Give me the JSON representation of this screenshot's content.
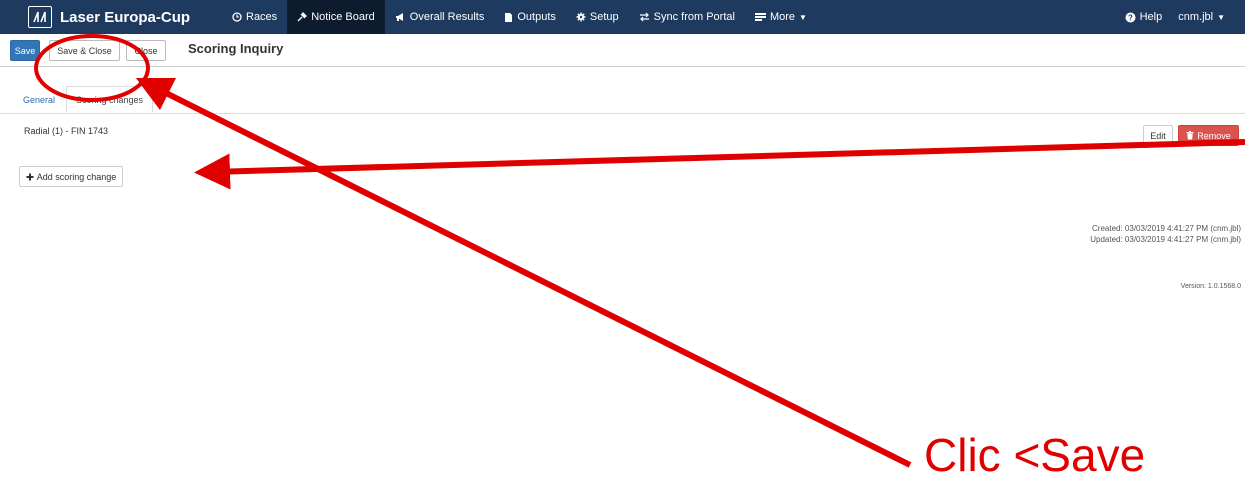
{
  "navbar": {
    "brand": "Laser Europa-Cup",
    "items": [
      {
        "label": "Races",
        "icon": "clock-icon"
      },
      {
        "label": "Notice Board",
        "icon": "pin-icon",
        "active": true
      },
      {
        "label": "Overall Results",
        "icon": "megaphone-icon"
      },
      {
        "label": "Outputs",
        "icon": "file-icon"
      },
      {
        "label": "Setup",
        "icon": "gear-icon"
      },
      {
        "label": "Sync from Portal",
        "icon": "sync-icon"
      },
      {
        "label": "More",
        "icon": "list-icon"
      }
    ],
    "help": "Help",
    "user": "cnm.jbl"
  },
  "toolbar": {
    "save": "Save",
    "save_close": "Save & Close",
    "close": "Close"
  },
  "page": {
    "title": "Scoring Inquiry"
  },
  "tabs": [
    {
      "label": "General"
    },
    {
      "label": "Scoring changes",
      "active": true
    }
  ],
  "scoring": {
    "item": "Radial (1) - FIN 1743",
    "edit": "Edit",
    "remove": "Remove",
    "add": "Add scoring change"
  },
  "meta": {
    "created": "Created: 03/03/2019 4:41:27 PM (cnm.jbl)",
    "updated": "Updated: 03/03/2019 4:41:27 PM (cnm.jbl)",
    "version": "Version: 1.0.1568.0"
  },
  "annotation": {
    "text": "Clic <Save"
  },
  "colors": {
    "navbar": "#1f3a5f",
    "primary": "#3376b8",
    "danger": "#d9534f",
    "annotation": "#e00000"
  }
}
